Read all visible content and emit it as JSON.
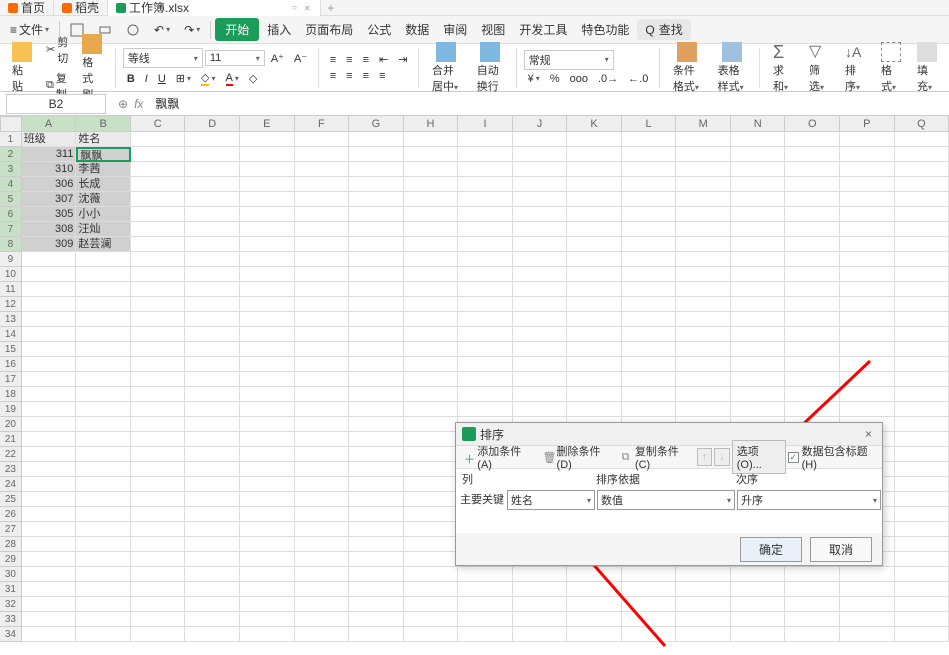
{
  "titlebar": {
    "tabs": [
      {
        "label": "首页",
        "icon": "orange"
      },
      {
        "label": "稻壳",
        "icon": "orange"
      },
      {
        "label": "工作簿.xlsx",
        "icon": "green"
      }
    ],
    "new_tab": "+"
  },
  "menubar": {
    "file": "文件",
    "items": [
      "开始",
      "插入",
      "页面布局",
      "公式",
      "数据",
      "审阅",
      "视图",
      "开发工具",
      "特色功能"
    ],
    "search_label": "查找",
    "search_icon": "Q"
  },
  "ribbon": {
    "paste": "粘贴",
    "cut": "剪切",
    "copy": "复制",
    "format_painter": "格式刷",
    "font": "等线",
    "font_size": "11",
    "bold": "B",
    "italic": "I",
    "underline": "U",
    "number_format": "常规",
    "merge": "合并居中",
    "wrap": "自动换行",
    "cond_format": "条件格式",
    "table_style": "表格样式",
    "sum": "求和",
    "filter": "筛选",
    "sort": "排序",
    "format": "格式",
    "fill": "填充"
  },
  "formula_bar": {
    "cell_ref": "B2",
    "fx": "fx",
    "value": "飘飘"
  },
  "columns": [
    "A",
    "B",
    "C",
    "D",
    "E",
    "F",
    "G",
    "H",
    "I",
    "J",
    "K",
    "L",
    "M",
    "N",
    "O",
    "P",
    "Q"
  ],
  "data_headers": {
    "A": "班级",
    "B": "姓名"
  },
  "data_rows": [
    {
      "A": "311",
      "B": "飘飘"
    },
    {
      "A": "310",
      "B": "李茜"
    },
    {
      "A": "306",
      "B": "长成"
    },
    {
      "A": "307",
      "B": "沈薇"
    },
    {
      "A": "305",
      "B": "小小"
    },
    {
      "A": "308",
      "B": "汪灿"
    },
    {
      "A": "309",
      "B": "赵芸澜"
    }
  ],
  "dialog": {
    "title": "排序",
    "add_condition": "添加条件(A)",
    "del_condition": "删除条件(D)",
    "copy_condition": "复制条件(C)",
    "options": "选项(O)...",
    "header_checkbox": "数据包含标题(H)",
    "header_checked": "✓",
    "col_header": "列",
    "sort_by_header": "排序依据",
    "order_header": "次序",
    "main_key_prefix": "主要关键",
    "main_key_value": "姓名",
    "sort_by_value": "数值",
    "order_value": "升序",
    "ok": "确定",
    "cancel": "取消",
    "close_x": "×"
  }
}
